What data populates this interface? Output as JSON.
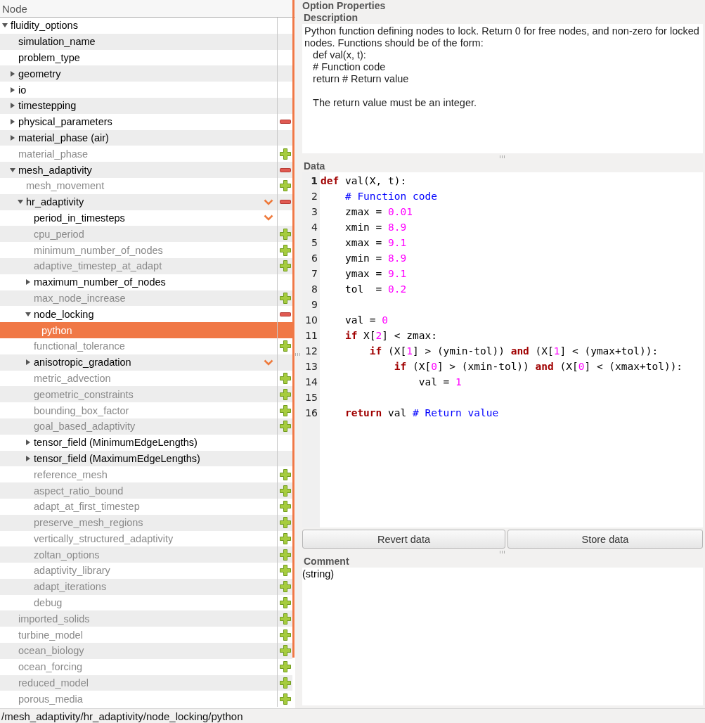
{
  "tree_header": "Node",
  "tree": [
    {
      "label": "fluidity_options",
      "active": true,
      "selected": false,
      "expanded": true,
      "children": [
        {
          "label": "simulation_name",
          "active": true,
          "selected": false
        },
        {
          "label": "problem_type",
          "active": true,
          "selected": false
        },
        {
          "label": "geometry",
          "active": true,
          "selected": false,
          "expanded": false
        },
        {
          "label": "io",
          "active": true,
          "selected": false,
          "expanded": false
        },
        {
          "label": "timestepping",
          "active": true,
          "selected": false,
          "expanded": false
        },
        {
          "label": "physical_parameters",
          "kind": "remove",
          "active": true,
          "selected": false,
          "expanded": false
        },
        {
          "label": "material_phase (air)",
          "active": true,
          "selected": false,
          "expanded": false
        },
        {
          "label": "material_phase",
          "kind": "add",
          "active": false,
          "selected": false
        },
        {
          "label": "mesh_adaptivity",
          "kind": "remove",
          "active": true,
          "selected": false,
          "expanded": true,
          "children": [
            {
              "label": "mesh_movement",
              "kind": "add",
              "active": false,
              "selected": false
            },
            {
              "label": "hr_adaptivity",
              "kind": "remove",
              "active": true,
              "selected": false,
              "expanded": true,
              "choice": true,
              "children": [
                {
                  "label": "period_in_timesteps",
                  "active": true,
                  "selected": false,
                  "choice": true
                },
                {
                  "label": "cpu_period",
                  "kind": "add",
                  "active": false,
                  "selected": false
                },
                {
                  "label": "minimum_number_of_nodes",
                  "kind": "add",
                  "active": false,
                  "selected": false
                },
                {
                  "label": "adaptive_timestep_at_adapt",
                  "kind": "add",
                  "active": false,
                  "selected": false
                },
                {
                  "label": "maximum_number_of_nodes",
                  "active": true,
                  "selected": false,
                  "expanded": false
                },
                {
                  "label": "max_node_increase",
                  "kind": "add",
                  "active": false,
                  "selected": false
                },
                {
                  "label": "node_locking",
                  "kind": "remove",
                  "active": true,
                  "selected": false,
                  "expanded": true,
                  "children": [
                    {
                      "label": "python",
                      "active": true,
                      "selected": true
                    }
                  ]
                },
                {
                  "label": "functional_tolerance",
                  "kind": "add",
                  "active": false,
                  "selected": false
                },
                {
                  "label": "anisotropic_gradation",
                  "active": true,
                  "selected": false,
                  "expanded": false,
                  "choice": true
                },
                {
                  "label": "metric_advection",
                  "kind": "add",
                  "active": false,
                  "selected": false
                },
                {
                  "label": "geometric_constraints",
                  "kind": "add",
                  "active": false,
                  "selected": false
                },
                {
                  "label": "bounding_box_factor",
                  "kind": "add",
                  "active": false,
                  "selected": false
                },
                {
                  "label": "goal_based_adaptivity",
                  "kind": "add",
                  "active": false,
                  "selected": false
                },
                {
                  "label": "tensor_field (MinimumEdgeLengths)",
                  "active": true,
                  "selected": false,
                  "expanded": false
                },
                {
                  "label": "tensor_field (MaximumEdgeLengths)",
                  "active": true,
                  "selected": false,
                  "expanded": false
                },
                {
                  "label": "reference_mesh",
                  "kind": "add",
                  "active": false,
                  "selected": false
                },
                {
                  "label": "aspect_ratio_bound",
                  "kind": "add",
                  "active": false,
                  "selected": false
                },
                {
                  "label": "adapt_at_first_timestep",
                  "kind": "add",
                  "active": false,
                  "selected": false
                },
                {
                  "label": "preserve_mesh_regions",
                  "kind": "add",
                  "active": false,
                  "selected": false
                },
                {
                  "label": "vertically_structured_adaptivity",
                  "kind": "add",
                  "active": false,
                  "selected": false
                },
                {
                  "label": "zoltan_options",
                  "kind": "add",
                  "active": false,
                  "selected": false
                },
                {
                  "label": "adaptivity_library",
                  "kind": "add",
                  "active": false,
                  "selected": false
                },
                {
                  "label": "adapt_iterations",
                  "kind": "add",
                  "active": false,
                  "selected": false
                },
                {
                  "label": "debug",
                  "kind": "add",
                  "active": false,
                  "selected": false
                }
              ]
            }
          ]
        },
        {
          "label": "imported_solids",
          "kind": "add",
          "active": false,
          "selected": false
        },
        {
          "label": "turbine_model",
          "kind": "add",
          "active": false,
          "selected": false
        },
        {
          "label": "ocean_biology",
          "kind": "add",
          "active": false,
          "selected": false
        },
        {
          "label": "ocean_forcing",
          "kind": "add",
          "active": false,
          "selected": false
        },
        {
          "label": "reduced_model",
          "kind": "add",
          "active": false,
          "selected": false
        },
        {
          "label": "porous_media",
          "kind": "add",
          "active": false,
          "selected": false
        }
      ]
    }
  ],
  "properties": {
    "title": "Option Properties",
    "description_label": "Description",
    "description": "Python function defining nodes to lock. Return 0 for free nodes, and non-zero for locked nodes. Functions should be of the form:\n   def val(x, t):\n   # Function code\n   return # Return value\n\n   The return value must be an integer.",
    "data_label": "Data",
    "code": [
      {
        "number": "1",
        "current": true,
        "tokens": [
          {
            "text": "def",
            "kind": "keyword"
          },
          {
            "text": " val(X, t):",
            "kind": "plain"
          }
        ]
      },
      {
        "number": "2",
        "current": false,
        "tokens": [
          {
            "text": "    # Function code",
            "kind": "comment"
          }
        ]
      },
      {
        "number": "3",
        "current": false,
        "tokens": [
          {
            "text": "    zmax = ",
            "kind": "plain"
          },
          {
            "text": "0.01",
            "kind": "number"
          }
        ]
      },
      {
        "number": "4",
        "current": false,
        "tokens": [
          {
            "text": "    xmin = ",
            "kind": "plain"
          },
          {
            "text": "8.9",
            "kind": "number"
          }
        ]
      },
      {
        "number": "5",
        "current": false,
        "tokens": [
          {
            "text": "    xmax = ",
            "kind": "plain"
          },
          {
            "text": "9.1",
            "kind": "number"
          }
        ]
      },
      {
        "number": "6",
        "current": false,
        "tokens": [
          {
            "text": "    ymin = ",
            "kind": "plain"
          },
          {
            "text": "8.9",
            "kind": "number"
          }
        ]
      },
      {
        "number": "7",
        "current": false,
        "tokens": [
          {
            "text": "    ymax = ",
            "kind": "plain"
          },
          {
            "text": "9.1",
            "kind": "number"
          }
        ]
      },
      {
        "number": "8",
        "current": false,
        "tokens": [
          {
            "text": "    tol  = ",
            "kind": "plain"
          },
          {
            "text": "0.2",
            "kind": "number"
          }
        ]
      },
      {
        "number": "9",
        "current": false
      },
      {
        "number": "10",
        "current": false,
        "tokens": [
          {
            "text": "    val = ",
            "kind": "plain"
          },
          {
            "text": "0",
            "kind": "number"
          }
        ]
      },
      {
        "number": "11",
        "current": false,
        "tokens": [
          {
            "text": "    if",
            "kind": "keyword"
          },
          {
            "text": " X[",
            "kind": "plain"
          },
          {
            "text": "2",
            "kind": "number"
          },
          {
            "text": "] < zmax:",
            "kind": "plain"
          }
        ]
      },
      {
        "number": "12",
        "current": false,
        "tokens": [
          {
            "text": "        if",
            "kind": "keyword"
          },
          {
            "text": " (X[",
            "kind": "plain"
          },
          {
            "text": "1",
            "kind": "number"
          },
          {
            "text": "] > (ymin-tol)) ",
            "kind": "plain"
          },
          {
            "text": "and",
            "kind": "keyword"
          },
          {
            "text": " (X[",
            "kind": "plain"
          },
          {
            "text": "1",
            "kind": "number"
          },
          {
            "text": "] < (ymax+tol)):",
            "kind": "plain"
          }
        ]
      },
      {
        "number": "13",
        "current": false,
        "tokens": [
          {
            "text": "            if",
            "kind": "keyword"
          },
          {
            "text": " (X[",
            "kind": "plain"
          },
          {
            "text": "0",
            "kind": "number"
          },
          {
            "text": "] > (xmin-tol)) ",
            "kind": "plain"
          },
          {
            "text": "and",
            "kind": "keyword"
          },
          {
            "text": " (X[",
            "kind": "plain"
          },
          {
            "text": "0",
            "kind": "number"
          },
          {
            "text": "] < (xmax+tol)):",
            "kind": "plain"
          }
        ]
      },
      {
        "number": "14",
        "current": false,
        "tokens": [
          {
            "text": "                val = ",
            "kind": "plain"
          },
          {
            "text": "1",
            "kind": "number"
          }
        ]
      },
      {
        "number": "15",
        "current": false
      },
      {
        "number": "16",
        "current": false,
        "tokens": [
          {
            "text": "    return",
            "kind": "keyword"
          },
          {
            "text": " val ",
            "kind": "plain"
          },
          {
            "text": "# Return value",
            "kind": "comment"
          }
        ]
      }
    ],
    "buttons": [
      "Revert data",
      "Store data"
    ],
    "comment_label": "Comment",
    "comment": "(string)"
  },
  "status_bar": "/mesh_adaptivity/hr_adaptivity/node_locking/python"
}
